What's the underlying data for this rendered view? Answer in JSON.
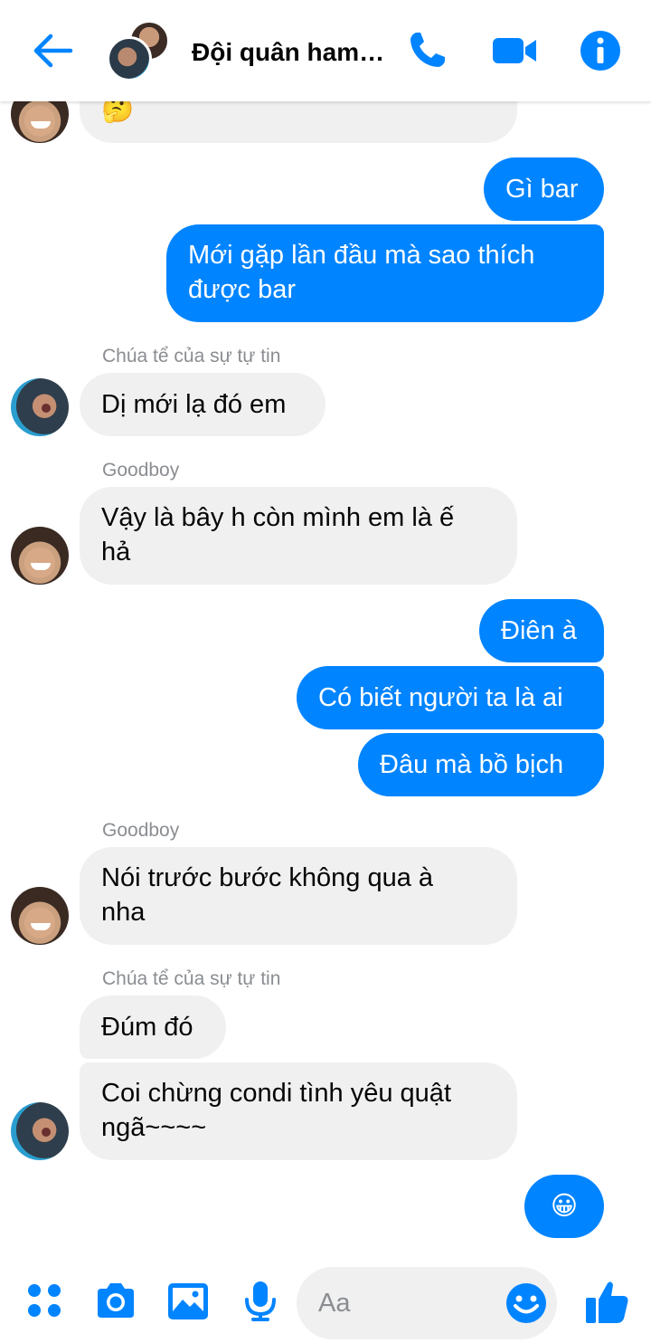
{
  "header": {
    "title": "Đội quân ham…",
    "icons": {
      "back": "arrow-left-icon",
      "call": "phone-icon",
      "video": "video-camera-icon",
      "info": "info-icon"
    },
    "accent_color": "#0084ff"
  },
  "messages": [
    {
      "direction": "in",
      "text": "🤔",
      "avatar": "goodboy"
    },
    {
      "direction": "out",
      "text": "Gì bar"
    },
    {
      "direction": "out",
      "lines": [
        "Mới gặp lần đầu mà sao thích",
        "được bar"
      ]
    },
    {
      "sender": "Chúa tể của sự tự tin",
      "direction": "in",
      "text": "Dị mới lạ đó em",
      "avatar": "chua"
    },
    {
      "sender": "Goodboy",
      "direction": "in",
      "lines": [
        "Vậy là bây h còn mình em là ế",
        "hả"
      ],
      "avatar": "goodboy"
    },
    {
      "direction": "out",
      "text": "Điên à"
    },
    {
      "direction": "out",
      "text": "Có biết người ta là ai"
    },
    {
      "direction": "out",
      "text": "Đâu mà bồ bịch"
    },
    {
      "sender": "Goodboy",
      "direction": "in",
      "lines": [
        "Nói trước bước không qua à",
        "nha"
      ],
      "avatar": "goodboy"
    },
    {
      "sender": "Chúa tể của sự tự tin",
      "direction": "in",
      "text": "Đúm đó"
    },
    {
      "direction": "in",
      "lines": [
        "Coi chừng condi tình yêu quật",
        "ngã~~~~"
      ],
      "avatar": "chua"
    },
    {
      "direction": "out",
      "text": "😀"
    }
  ],
  "composer": {
    "placeholder": "Aa",
    "icons": [
      "menu-dots-icon",
      "camera-icon",
      "gallery-icon",
      "microphone-icon",
      "emoji-icon",
      "like-icon"
    ]
  },
  "colors": {
    "outgoing_bubble": "#0084ff",
    "incoming_bubble": "#f0f0f0",
    "sender_name": "#8a8d91"
  }
}
